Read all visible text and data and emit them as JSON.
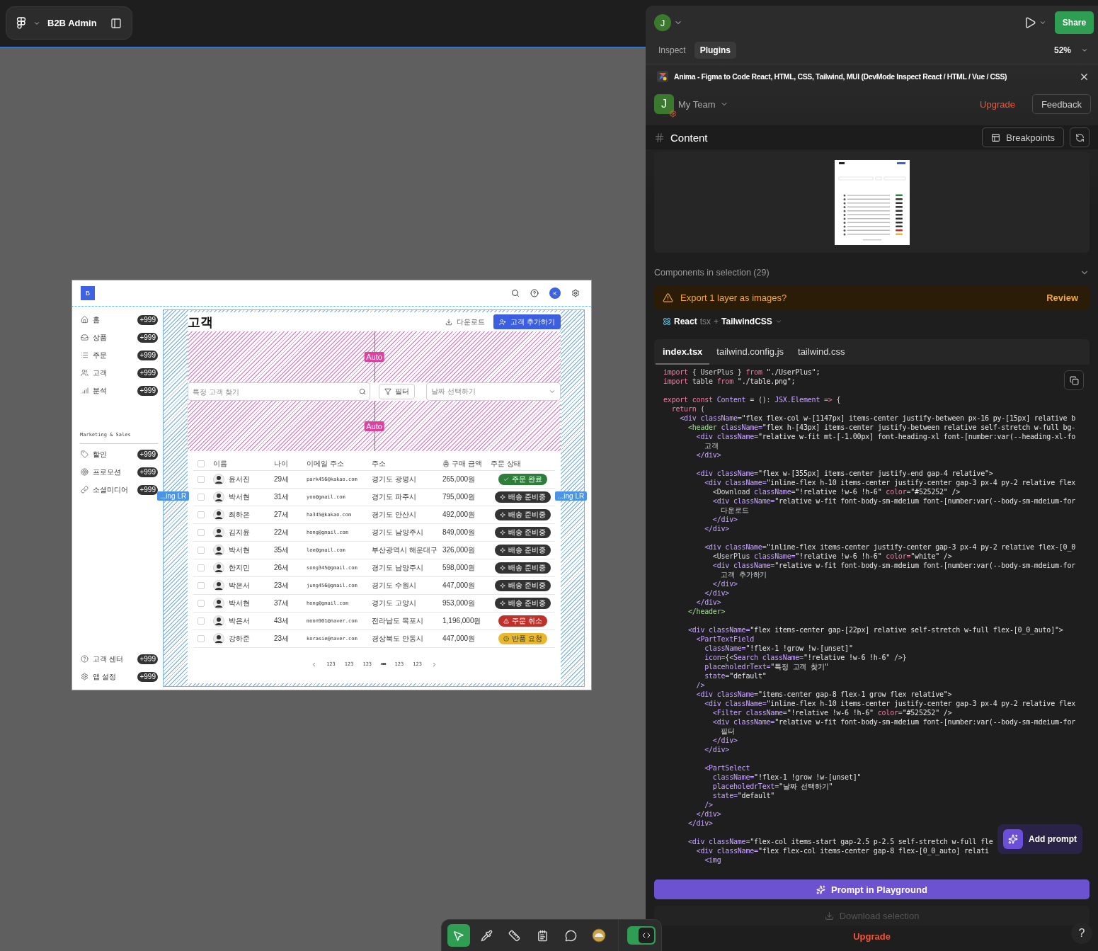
{
  "file_pill": {
    "title": "B2B Admin"
  },
  "frame": {
    "header": {
      "logo": "B",
      "avatar": "K"
    },
    "sidebar": {
      "items": [
        {
          "label": "홈",
          "badge": "+999"
        },
        {
          "label": "상품",
          "badge": "+999"
        },
        {
          "label": "주문",
          "badge": "+999"
        },
        {
          "label": "고객",
          "badge": "+999"
        },
        {
          "label": "분석",
          "badge": "+999"
        }
      ],
      "section_title": "Marketing & Sales",
      "marketing_items": [
        {
          "label": "할인",
          "badge": "+999"
        },
        {
          "label": "프로모션",
          "badge": "+999"
        },
        {
          "label": "소셜미디어",
          "badge": "+999"
        }
      ],
      "footer_items": [
        {
          "label": "고객 센터",
          "badge": "+999"
        },
        {
          "label": "앱 설정",
          "badge": "+999"
        }
      ]
    },
    "page_title": "고객",
    "download_button": "다운로드",
    "add_button": "고객 추가하기",
    "search": {
      "placeholder": "특정 고객 찾기"
    },
    "filter_button": "필터",
    "date_select": {
      "placeholder": "날짜 선택하기"
    },
    "table": {
      "all_checked": false,
      "columns": [
        "이름",
        "나이",
        "이메일 주소",
        "주소",
        "총 구매 금액",
        "주문 상태"
      ],
      "rows": [
        {
          "checked": false,
          "name": "윤서진",
          "age": "29세",
          "email": "park456@kakao.com",
          "address": "경기도 광명시",
          "total": "265,000원",
          "status": {
            "label": "주문 완료",
            "kind": "done",
            "color": "#2e7d3a"
          }
        },
        {
          "checked": false,
          "name": "박서현",
          "age": "31세",
          "email": "yoo@gmail.com",
          "address": "경기도 파주시",
          "total": "795,000원",
          "status": {
            "label": "배송 준비중",
            "kind": "shipping",
            "color": "#333333"
          }
        },
        {
          "checked": false,
          "name": "최하은",
          "age": "27세",
          "email": "ha345@kakao.com",
          "address": "경기도 안산시",
          "total": "492,000원",
          "status": {
            "label": "배송 준비중",
            "kind": "shipping",
            "color": "#333333"
          }
        },
        {
          "checked": false,
          "name": "김지윤",
          "age": "22세",
          "email": "hong@gmail.com",
          "address": "경기도 남양주시",
          "total": "849,000원",
          "status": {
            "label": "배송 준비중",
            "kind": "shipping",
            "color": "#333333"
          }
        },
        {
          "checked": false,
          "name": "박서현",
          "age": "35세",
          "email": "lee@gmail.com",
          "address": "부산광역시 해운대구",
          "total": "326,000원",
          "status": {
            "label": "배송 준비중",
            "kind": "shipping",
            "color": "#333333"
          }
        },
        {
          "checked": false,
          "name": "한지민",
          "age": "26세",
          "email": "song345@gmail.com",
          "address": "경기도 남양주시",
          "total": "598,000원",
          "status": {
            "label": "배송 준비중",
            "kind": "shipping",
            "color": "#333333"
          }
        },
        {
          "checked": false,
          "name": "박은서",
          "age": "23세",
          "email": "jung456@gmail.com",
          "address": "경기도 수원시",
          "total": "447,000원",
          "status": {
            "label": "배송 준비중",
            "kind": "shipping",
            "color": "#333333"
          }
        },
        {
          "checked": false,
          "name": "박서현",
          "age": "37세",
          "email": "hong@gmail.com",
          "address": "경기도 고양시",
          "total": "953,000원",
          "status": {
            "label": "배송 준비중",
            "kind": "shipping",
            "color": "#333333"
          }
        },
        {
          "checked": false,
          "name": "박은서",
          "age": "43세",
          "email": "moon901@naver.com",
          "address": "전라남도 목포시",
          "total": "1,196,000원",
          "status": {
            "label": "주문 취소",
            "kind": "cancel",
            "color": "#c0302a"
          }
        },
        {
          "checked": false,
          "name": "강하준",
          "age": "23세",
          "email": "korasie@naver.com",
          "address": "경상북도 안동시",
          "total": "447,000원",
          "status": {
            "label": "반품 요청",
            "kind": "return",
            "color": "#e8b82e"
          }
        }
      ]
    },
    "pagination": {
      "items": [
        {
          "kind": "page",
          "label": "123"
        },
        {
          "kind": "page",
          "label": "123"
        },
        {
          "kind": "page",
          "label": "123"
        },
        {
          "kind": "ellipsis",
          "label": "•••"
        },
        {
          "kind": "page",
          "label": "123"
        },
        {
          "kind": "page",
          "label": "123"
        }
      ]
    }
  },
  "overlays": {
    "spacing_labels": [
      "Auto",
      "Auto"
    ],
    "padding_labels": [
      "...ing LR",
      "...ing LR"
    ]
  },
  "panel": {
    "user_avatar": "J",
    "share_button": "Share",
    "tabs": [
      {
        "label": "Inspect",
        "selected": false
      },
      {
        "label": "Plugins",
        "selected": true
      }
    ],
    "zoom": "52%",
    "plugin_title": "Anima - Figma to Code React, HTML, CSS, Tailwind, MUI (DevMode Inspect React / HTML / Vue / CSS)",
    "team": {
      "avatar": "J",
      "name": "My Team"
    },
    "upgrade_link": "Upgrade",
    "feedback_button": "Feedback",
    "content_title": "Content",
    "breakpoints_button": "Breakpoints",
    "components_summary": "Components in selection (29)",
    "export_banner": {
      "message": "Export 1 layer as images?",
      "action": "Review"
    },
    "framework": {
      "name": "React",
      "ext": "tsx",
      "plus": "+",
      "styling": "TailwindCSS"
    },
    "file_tabs": [
      {
        "label": "index.tsx",
        "selected": true
      },
      {
        "label": "tailwind.config.js",
        "selected": false
      },
      {
        "label": "tailwind.css",
        "selected": false
      }
    ],
    "code": {
      "lines": [
        {
          "kind": "code",
          "parts": [
            {
              "kind": "keyword",
              "text": "import"
            },
            {
              "kind": "plain",
              "text": " { UserPlus } "
            },
            {
              "kind": "keyword",
              "text": "from"
            },
            {
              "kind": "string",
              "text": " \"./UserPlus\";"
            }
          ]
        },
        {
          "kind": "code",
          "parts": [
            {
              "kind": "keyword",
              "text": "import"
            },
            {
              "kind": "plain",
              "text": " table "
            },
            {
              "kind": "keyword",
              "text": "from"
            },
            {
              "kind": "string",
              "text": " \"./table.png\";"
            }
          ]
        },
        {
          "kind": "blank"
        },
        {
          "kind": "code",
          "parts": [
            {
              "kind": "keyword",
              "text": "export const"
            },
            {
              "kind": "tag",
              "text": " Content"
            },
            {
              "kind": "plain",
              "text": " = (): "
            },
            {
              "kind": "tag",
              "text": "JSX.Element"
            },
            {
              "kind": "keyword",
              "text": " =>"
            },
            {
              "kind": "plain",
              "text": " {"
            }
          ]
        },
        {
          "kind": "code",
          "parts": [
            {
              "kind": "keyword",
              "text": "  return"
            },
            {
              "kind": "plain",
              "text": " ("
            }
          ]
        },
        {
          "kind": "code",
          "parts": [
            {
              "kind": "tag",
              "text": "    <div className="
            },
            {
              "kind": "string",
              "text": "\"flex flex-col w-[1147px] items-center justify-between px-16 py-[15px] relative b"
            }
          ]
        },
        {
          "kind": "code",
          "parts": [
            {
              "kind": "element",
              "text": "      <header"
            },
            {
              "kind": "tag",
              "text": " className="
            },
            {
              "kind": "string",
              "text": "\"flex h-[43px] items-center justify-between relative self-stretch w-full bg-"
            }
          ]
        },
        {
          "kind": "code",
          "parts": [
            {
              "kind": "tag",
              "text": "        <div className="
            },
            {
              "kind": "string",
              "text": "\"relative w-fit mt-[-1.00px] font-heading-xl font-[number:var(--heading-xl-fo"
            }
          ]
        },
        {
          "kind": "code",
          "parts": [
            {
              "kind": "plain",
              "text": "          고객"
            }
          ]
        },
        {
          "kind": "code",
          "parts": [
            {
              "kind": "tag",
              "text": "        </div>"
            }
          ]
        },
        {
          "kind": "blank"
        },
        {
          "kind": "code",
          "parts": [
            {
              "kind": "tag",
              "text": "        <div className="
            },
            {
              "kind": "string",
              "text": "\"flex w-[355px] items-center justify-end gap-4 relative\">"
            }
          ]
        },
        {
          "kind": "code",
          "parts": [
            {
              "kind": "tag",
              "text": "          <div className="
            },
            {
              "kind": "string",
              "text": "\"inline-flex h-10 items-center justify-center gap-3 px-4 py-2 relative flex"
            }
          ]
        },
        {
          "kind": "code",
          "parts": [
            {
              "kind": "plain",
              "text": "            <Download "
            },
            {
              "kind": "tag",
              "text": "className="
            },
            {
              "kind": "string",
              "text": "\"!relative !w-6 !h-6\" "
            },
            {
              "kind": "keyword",
              "text": "color="
            },
            {
              "kind": "string",
              "text": "\"#525252\" />"
            }
          ]
        },
        {
          "kind": "code",
          "parts": [
            {
              "kind": "tag",
              "text": "            <div className="
            },
            {
              "kind": "string",
              "text": "\"relative w-fit font-body-sm-mdeium font-[number:var(--body-sm-mdeium-for"
            }
          ]
        },
        {
          "kind": "code",
          "parts": [
            {
              "kind": "plain",
              "text": "              다운로드"
            }
          ]
        },
        {
          "kind": "code",
          "parts": [
            {
              "kind": "tag",
              "text": "            </div>"
            }
          ]
        },
        {
          "kind": "code",
          "parts": [
            {
              "kind": "tag",
              "text": "          </div>"
            }
          ]
        },
        {
          "kind": "blank"
        },
        {
          "kind": "code",
          "parts": [
            {
              "kind": "tag",
              "text": "          <div className="
            },
            {
              "kind": "string",
              "text": "\"inline-flex items-center justify-center gap-3 px-4 py-2 relative flex-[0_0"
            }
          ]
        },
        {
          "kind": "code",
          "parts": [
            {
              "kind": "plain",
              "text": "            <UserPlus "
            },
            {
              "kind": "tag",
              "text": "className="
            },
            {
              "kind": "string",
              "text": "\"!relative !w-6 !h-6\" "
            },
            {
              "kind": "keyword",
              "text": "color="
            },
            {
              "kind": "string",
              "text": "\"white\" />"
            }
          ]
        },
        {
          "kind": "code",
          "parts": [
            {
              "kind": "tag",
              "text": "            <div className="
            },
            {
              "kind": "string",
              "text": "\"relative w-fit font-body-sm-mdeium font-[number:var(--body-sm-mdeium-for"
            }
          ]
        },
        {
          "kind": "code",
          "parts": [
            {
              "kind": "plain",
              "text": "              고객 추가하기"
            }
          ]
        },
        {
          "kind": "code",
          "parts": [
            {
              "kind": "tag",
              "text": "            </div>"
            }
          ]
        },
        {
          "kind": "code",
          "parts": [
            {
              "kind": "tag",
              "text": "          </div>"
            }
          ]
        },
        {
          "kind": "code",
          "parts": [
            {
              "kind": "tag",
              "text": "        </div>"
            }
          ]
        },
        {
          "kind": "code",
          "parts": [
            {
              "kind": "element",
              "text": "      </header>"
            }
          ]
        },
        {
          "kind": "blank"
        },
        {
          "kind": "code",
          "parts": [
            {
              "kind": "tag",
              "text": "      <div className="
            },
            {
              "kind": "string",
              "text": "\"flex items-center gap-[22px] relative self-stretch w-full flex-[0_0_auto]\">"
            }
          ]
        },
        {
          "kind": "code",
          "parts": [
            {
              "kind": "tag",
              "text": "        <PartTextField"
            }
          ]
        },
        {
          "kind": "code",
          "parts": [
            {
              "kind": "tag",
              "text": "          className="
            },
            {
              "kind": "string",
              "text": "\"!flex-1 !grow !w-[unset]\""
            }
          ]
        },
        {
          "kind": "code",
          "parts": [
            {
              "kind": "tag",
              "text": "          icon="
            },
            {
              "kind": "plain",
              "text": "{<"
            },
            {
              "kind": "tag",
              "text": "Search className="
            },
            {
              "kind": "string",
              "text": "\"!relative !w-6 !h-6\""
            },
            {
              "kind": "plain",
              "text": " />}"
            }
          ]
        },
        {
          "kind": "code",
          "parts": [
            {
              "kind": "tag",
              "text": "          placeholedrText="
            },
            {
              "kind": "string",
              "text": "\"특정 고객 찾기\""
            }
          ]
        },
        {
          "kind": "code",
          "parts": [
            {
              "kind": "tag",
              "text": "          state="
            },
            {
              "kind": "string",
              "text": "\"default\""
            }
          ]
        },
        {
          "kind": "code",
          "parts": [
            {
              "kind": "tag",
              "text": "        />"
            }
          ]
        },
        {
          "kind": "code",
          "parts": [
            {
              "kind": "tag",
              "text": "        <div className="
            },
            {
              "kind": "string",
              "text": "\"items-center gap-8 flex-1 grow flex relative\">"
            }
          ]
        },
        {
          "kind": "code",
          "parts": [
            {
              "kind": "tag",
              "text": "          <div className="
            },
            {
              "kind": "string",
              "text": "\"inline-flex h-10 items-center justify-center gap-3 px-4 py-2 relative flex"
            }
          ]
        },
        {
          "kind": "code",
          "parts": [
            {
              "kind": "tag",
              "text": "            <Filter className="
            },
            {
              "kind": "string",
              "text": "\"!relative !w-6 !h-6\" "
            },
            {
              "kind": "keyword",
              "text": "color="
            },
            {
              "kind": "string",
              "text": "\"#525252\" />"
            }
          ]
        },
        {
          "kind": "code",
          "parts": [
            {
              "kind": "tag",
              "text": "            <div className="
            },
            {
              "kind": "string",
              "text": "\"relative w-fit font-body-sm-mdeium font-[number:var(--body-sm-mdeium-for"
            }
          ]
        },
        {
          "kind": "code",
          "parts": [
            {
              "kind": "plain",
              "text": "              필터"
            }
          ]
        },
        {
          "kind": "code",
          "parts": [
            {
              "kind": "tag",
              "text": "            </div>"
            }
          ]
        },
        {
          "kind": "code",
          "parts": [
            {
              "kind": "tag",
              "text": "          </div>"
            }
          ]
        },
        {
          "kind": "blank"
        },
        {
          "kind": "code",
          "parts": [
            {
              "kind": "tag",
              "text": "          <PartSelect"
            }
          ]
        },
        {
          "kind": "code",
          "parts": [
            {
              "kind": "tag",
              "text": "            className="
            },
            {
              "kind": "string",
              "text": "\"!flex-1 !grow !w-[unset]\""
            }
          ]
        },
        {
          "kind": "code",
          "parts": [
            {
              "kind": "tag",
              "text": "            placeholedrText="
            },
            {
              "kind": "string",
              "text": "\"날짜 선택하기\""
            }
          ]
        },
        {
          "kind": "code",
          "parts": [
            {
              "kind": "tag",
              "text": "            state="
            },
            {
              "kind": "string",
              "text": "\"default\""
            }
          ]
        },
        {
          "kind": "code",
          "parts": [
            {
              "kind": "tag",
              "text": "          />"
            }
          ]
        },
        {
          "kind": "code",
          "parts": [
            {
              "kind": "tag",
              "text": "        </div>"
            }
          ]
        },
        {
          "kind": "code",
          "parts": [
            {
              "kind": "tag",
              "text": "      </div>"
            }
          ]
        },
        {
          "kind": "blank"
        },
        {
          "kind": "code",
          "parts": [
            {
              "kind": "tag",
              "text": "      <div className="
            },
            {
              "kind": "string",
              "text": "\"flex-col items-start gap-2.5 p-2.5 self-stretch w-full fle"
            }
          ]
        },
        {
          "kind": "code",
          "parts": [
            {
              "kind": "tag",
              "text": "        <div className="
            },
            {
              "kind": "string",
              "text": "\"flex flex-col items-center gap-8 flex-[0_0_auto] relati"
            }
          ]
        },
        {
          "kind": "code",
          "parts": [
            {
              "kind": "tag",
              "text": "          <img"
            }
          ]
        }
      ]
    },
    "add_prompt_button": "Add prompt",
    "playground_button": "Prompt in Playground",
    "download_button": {
      "label": "Download selection",
      "disabled": true
    },
    "footer_upgrade": "Upgrade",
    "help_button": "?"
  },
  "toolbar": {
    "tools": [
      {
        "selected": true
      },
      {
        "selected": false
      },
      {
        "selected": false
      },
      {
        "selected": false
      },
      {
        "selected": false
      },
      {
        "selected": false
      }
    ],
    "dev_mode": {
      "on": true
    }
  }
}
